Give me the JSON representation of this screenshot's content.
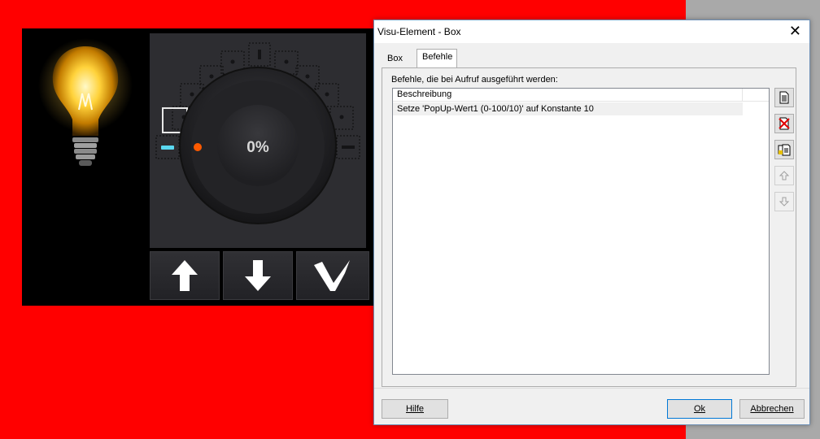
{
  "dimmer": {
    "percent_text": "0%",
    "level": 0,
    "buttons": [
      {
        "name": "up-arrow-button",
        "icon": "arrow-up-icon"
      },
      {
        "name": "down-arrow-button",
        "icon": "arrow-down-icon"
      },
      {
        "name": "confirm-button",
        "icon": "checkmark-icon"
      }
    ],
    "colors": {
      "accent_cyan": "#5ad8f0",
      "indicator_orange": "#ff5a00",
      "panel_bg": "#2d2d31"
    }
  },
  "dialog": {
    "title": "Visu-Element - Box",
    "tabs": [
      {
        "label": "Box"
      },
      {
        "label": "Befehle"
      }
    ],
    "section_label": "Befehle, die bei Aufruf ausgeführt werden:",
    "list": {
      "header": "Beschreibung",
      "rows": [
        "Setze 'PopUp-Wert1 (0-100/10)' auf Konstante 10"
      ]
    },
    "side_buttons": [
      "new-document-icon",
      "delete-icon",
      "edit-icon",
      "move-up-icon",
      "move-down-icon"
    ],
    "buttons": {
      "help": "Hilfe",
      "ok": "Ok",
      "cancel": "Abbrechen"
    }
  }
}
